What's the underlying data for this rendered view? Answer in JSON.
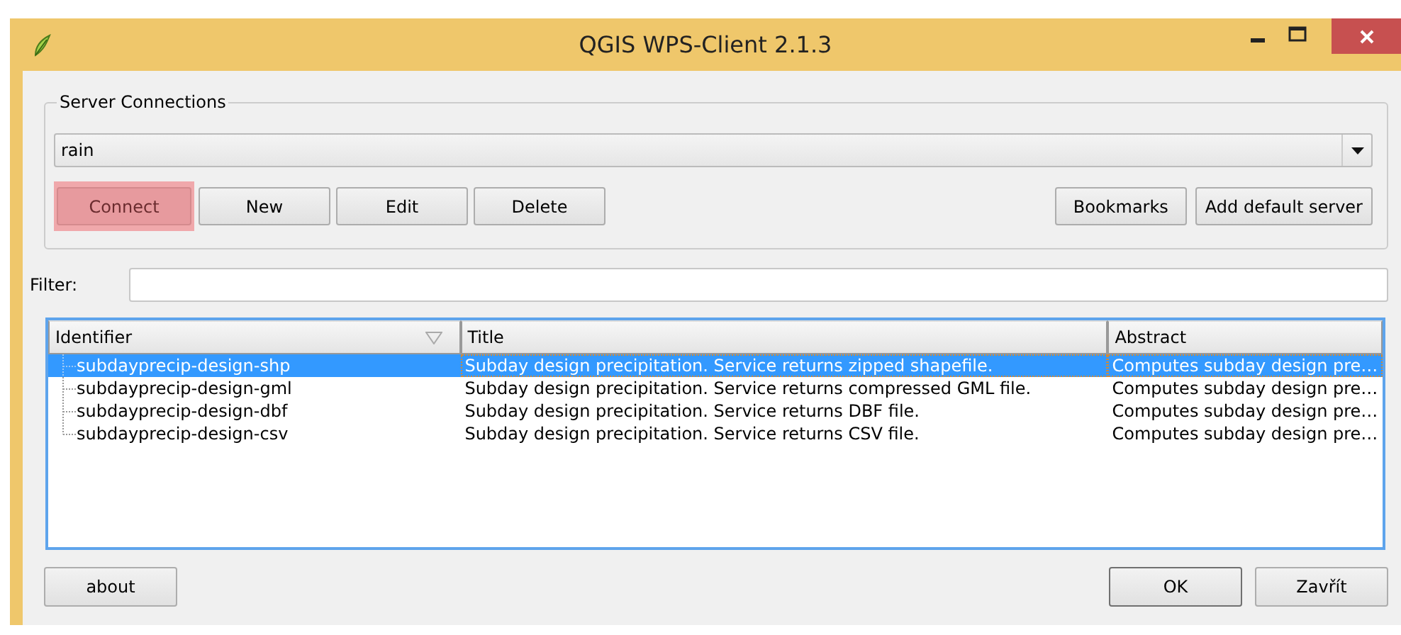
{
  "window": {
    "title": "QGIS WPS-Client 2.1.3"
  },
  "server_connections": {
    "title": "Server Connections",
    "selected_server": "rain",
    "buttons": [
      {
        "label": "Connect",
        "highlighted": true
      },
      {
        "label": "New",
        "highlighted": false
      },
      {
        "label": "Edit",
        "highlighted": false
      },
      {
        "label": "Delete",
        "highlighted": false
      }
    ],
    "right_buttons": [
      {
        "label": "Bookmarks"
      },
      {
        "label": "Add default server"
      }
    ]
  },
  "filter": {
    "label": "Filter:"
  },
  "table": {
    "columns": [
      "Identifier",
      "Title",
      "Abstract"
    ],
    "rows": [
      {
        "cells": [
          "subdayprecip-design-shp",
          "Subday design precipitation. Service returns zipped shapefile.",
          "Computes subday design pre…"
        ],
        "selected": true
      },
      {
        "cells": [
          "subdayprecip-design-gml",
          "Subday design precipitation. Service returns compressed GML file.",
          "Computes subday design pre…"
        ],
        "selected": false
      },
      {
        "cells": [
          "subdayprecip-design-dbf",
          "Subday design precipitation. Service returns DBF file.",
          "Computes subday design pre…"
        ],
        "selected": false
      },
      {
        "cells": [
          "subdayprecip-design-csv",
          "Subday design precipitation. Service returns CSV file.",
          "Computes subday design pre…"
        ],
        "selected": false
      }
    ]
  },
  "footer": {
    "left_button": {
      "label": "about"
    },
    "buttons": [
      {
        "label": "OK",
        "default": true
      },
      {
        "label": "Zavřít",
        "default": false
      }
    ]
  }
}
